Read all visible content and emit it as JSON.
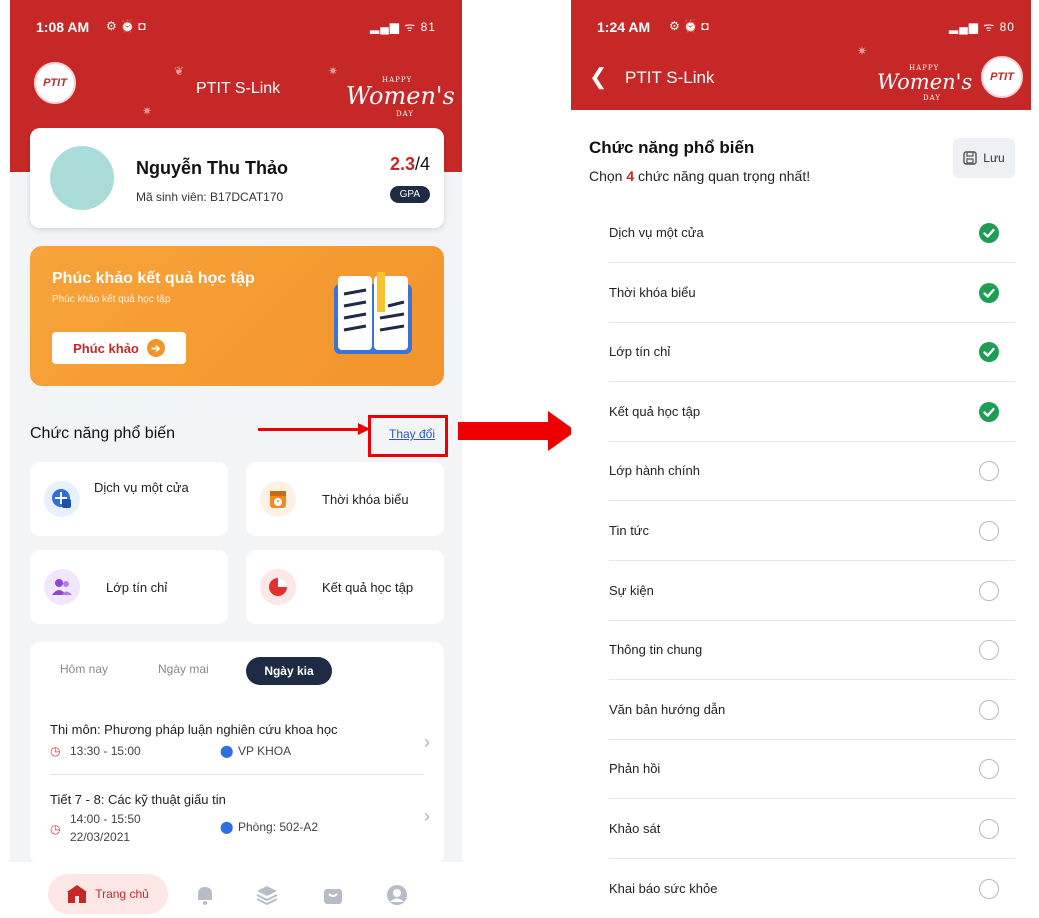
{
  "left": {
    "status_time": "1:08 AM",
    "status_right": "81",
    "app_title": "PTIT S-Link",
    "logo_text": "PTIT",
    "womens_day": {
      "main": "Women's",
      "happy": "HAPPY",
      "day": "DAY"
    },
    "profile": {
      "name": "Nguyễn Thu Thảo",
      "student_id": "Mã sinh viên: B17DCAT170",
      "gpa_value": "2.3",
      "gpa_max": "/4",
      "gpa_label": "GPA"
    },
    "banner": {
      "title": "Phúc khảo kết quả học tập",
      "subtitle": "Phúc khảo kết quả học tập",
      "button": "Phúc khảo"
    },
    "section_title": "Chức năng phổ biến",
    "change_link": "Thay đổi",
    "functions": [
      {
        "label": "Dịch vụ một cửa",
        "icon": "one-stop-service-icon",
        "color": "#2f6fe4",
        "bg": "#e8f0fd"
      },
      {
        "label": "Thời khóa biểu",
        "icon": "timetable-icon",
        "color": "#f08a24",
        "bg": "#fdf1e4"
      },
      {
        "label": "Lớp tín chỉ",
        "icon": "credit-class-icon",
        "color": "#8e44d6",
        "bg": "#f1e7fb"
      },
      {
        "label": "Kết quả học tập",
        "icon": "study-result-icon",
        "color": "#e03131",
        "bg": "#fde6e6"
      }
    ],
    "schedule": {
      "tabs": [
        "Hôm nay",
        "Ngày mai",
        "Ngày kia"
      ],
      "active_tab": "Ngày kia",
      "items": [
        {
          "title": "Thi môn: Phương pháp luận nghiên cứu khoa học",
          "time": "13:30 - 15:00",
          "place": "VP KHOA"
        },
        {
          "title": "Tiết 7 - 8: Các kỹ thuật giấu tin",
          "time": "14:00 - 15:50",
          "date": "22/03/2021",
          "place": "Phòng: 502-A2"
        }
      ]
    },
    "bottom_nav": {
      "home_label": "Trang chủ",
      "icons": [
        "bell-icon",
        "layers-icon",
        "bag-icon",
        "profile-icon"
      ]
    }
  },
  "right": {
    "status_time": "1:24 AM",
    "status_right": "80",
    "app_title": "PTIT S-Link",
    "section_title": "Chức năng phổ biến",
    "subtitle_prefix": "Chọn ",
    "subtitle_count": "4",
    "subtitle_suffix": " chức năng quan trọng nhất!",
    "save_label": "Lưu",
    "options": [
      {
        "label": "Dịch vụ một cửa",
        "checked": true
      },
      {
        "label": "Thời khóa biểu",
        "checked": true
      },
      {
        "label": "Lớp tín chỉ",
        "checked": true
      },
      {
        "label": "Kết quả học tập",
        "checked": true
      },
      {
        "label": "Lớp hành chính",
        "checked": false
      },
      {
        "label": "Tin tức",
        "checked": false
      },
      {
        "label": "Sự kiện",
        "checked": false
      },
      {
        "label": "Thông tin chung",
        "checked": false
      },
      {
        "label": "Văn bản hướng dẫn",
        "checked": false
      },
      {
        "label": "Phản hồi",
        "checked": false
      },
      {
        "label": "Khảo sát",
        "checked": false
      },
      {
        "label": "Khai báo sức khỏe",
        "checked": false
      }
    ]
  },
  "colors": {
    "brand_red": "#c62828",
    "navy": "#1f2a44",
    "check_green": "#1f9d55",
    "annotation_red": "#ee0000"
  }
}
